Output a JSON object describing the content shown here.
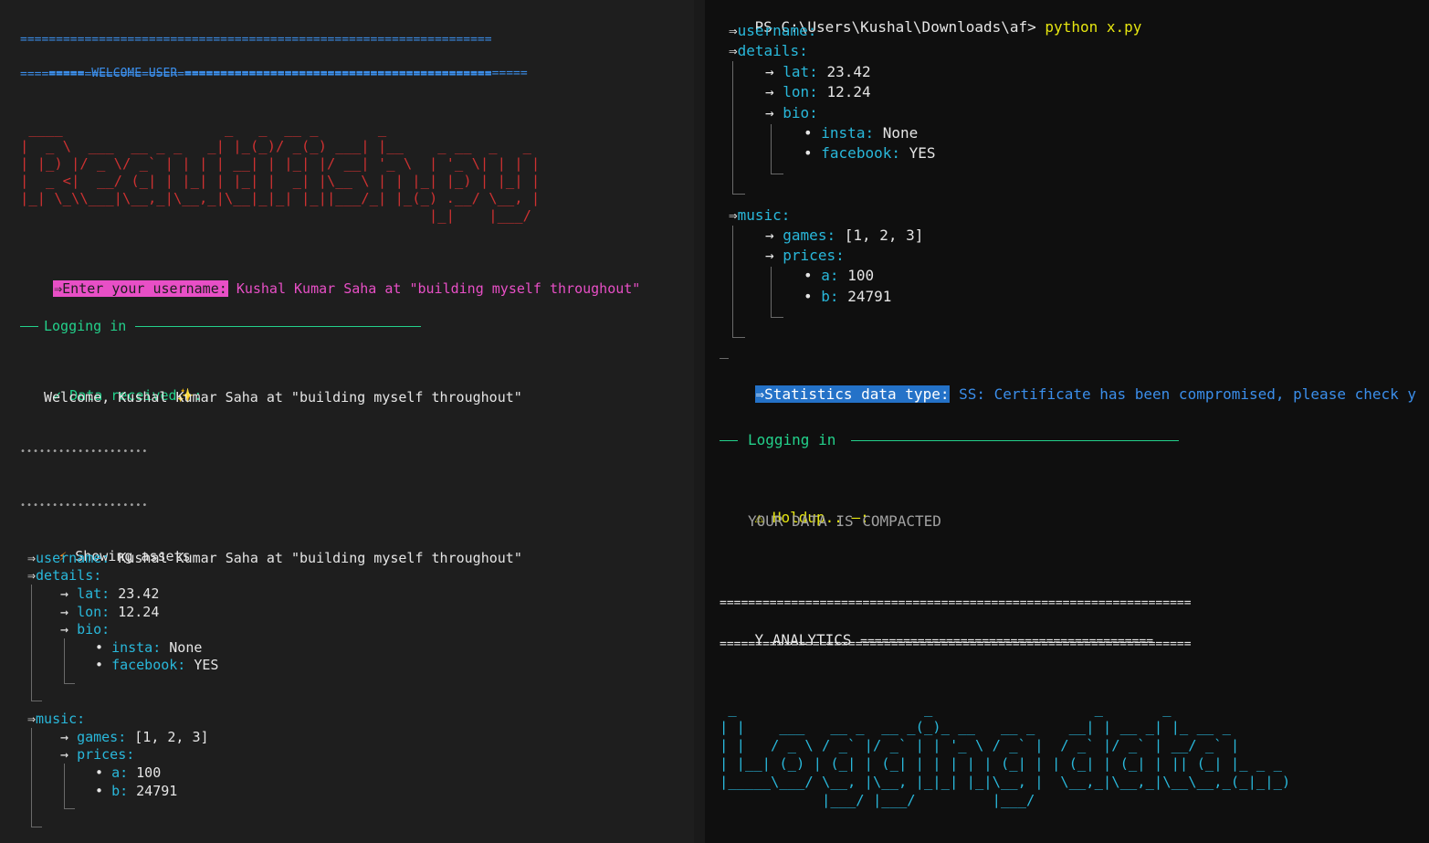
{
  "left": {
    "banner": {
      "line1": "==================================================================",
      "line2_label": "===== WELCOME USER",
      "line2_tail": "================================================",
      "line3": "=================================================================="
    },
    "ascii_title": " ____                   _   _  __ _       _                       \n|  _ \\  ___  __ _ _   _| |_(_)/ _(_) ___| |__    _ __  _   _    \n| |_) |/ _ \\/ _` | | | | __| | |_| |/ __| '_ \\  | '_ \\| | | |   \n|  _ <|  __/ (_| | |_| | |_| |  _| |\\__ \\ | | |_| |_) | |_| |   \n|_| \\_\\\\___|\\__,_|\\__,_|\\__|_|_| |_||___/_| |_(_) .__/ \\__, |   \n                                                |_|    |___/    ",
    "prompt": {
      "arrow": "⇒",
      "label": "Enter your username:",
      "value": "Kushal Kumar Saha at \"building myself throughout\""
    },
    "logging_title": "Logging in",
    "check_icon": "✓",
    "received_label": "Data received",
    "sparkle_icon": "✨",
    "welcome_text": "Welcome, Kushal Kumar Saha at \"building myself throughout\"",
    "dots1": "••••••••••••••••••••",
    "dots2": "••••••••••••••••••••",
    "assets_icon": "⚡",
    "assets_label": "Showing assets",
    "username_key": "username:",
    "username_value": "Kushal Kumar Saha at \"building myself throughout\"",
    "details_key": "details:",
    "lat_key": "lat:",
    "lat_value": "23.42",
    "lon_key": "lon:",
    "lon_value": "12.24",
    "bio_key": "bio:",
    "insta_key": "insta:",
    "insta_value": "None",
    "facebook_key": "facebook:",
    "facebook_value": "YES",
    "music_key": "music:",
    "games_key": "games:",
    "games_value": "[1, 2, 3]",
    "prices_key": "prices:",
    "a_key": "a:",
    "a_value": "100",
    "b_key": "b:",
    "b_value": "24791"
  },
  "right": {
    "ps_prompt": "PS C:\\Users\\Kushal\\Downloads\\af>",
    "ps_command": "python x.py",
    "username_key": "username:",
    "details_key": "details:",
    "lat_key": "lat:",
    "lat_value": "23.42",
    "lon_key": "lon:",
    "lon_value": "12.24",
    "bio_key": "bio:",
    "insta_key": "insta:",
    "insta_value": "None",
    "facebook_key": "facebook:",
    "facebook_value": "YES",
    "music_key": "music:",
    "games_key": "games:",
    "games_value": "[1, 2, 3]",
    "prices_key": "prices:",
    "a_key": "a:",
    "a_value": "100",
    "b_key": "b:",
    "b_value": "24791",
    "stats": {
      "arrow": "⇒",
      "label": "Statistics data type:",
      "value": "SS: Certificate has been compromised, please check y"
    },
    "logging_title": "Logging in",
    "warn_icon": "⚠",
    "holdup_label": "Holdup.. —:",
    "compacted_text": "YOUR DATA IS COMPACTED",
    "banner": {
      "line1": "==================================================================",
      "line2_label": "Y ANALYTICS",
      "line2_tail": "=========================================",
      "line3": "=================================================================="
    },
    "ascii_logging": " _                      _                   _       _          \n| |    ___   __ _  __ _(_)_ __   __ _    __| | __ _| |_ __ _    \n| |   / _ \\ / _` |/ _` | | '_ \\ / _` |  / _` |/ _` | __/ _` |   \n| |__| (_) | (_| | (_| | | | | | (_| | | (_| | (_| | || (_| |_ _ _\n|_____\\___/ \\__, |\\__, |_|_| |_|\\__, |  \\__,_|\\__,_|\\__\\__,_(_|_|_)\n            |___/ |___/         |___/                              "
  },
  "colors": {
    "cyan": "#29b8db",
    "blue": "#3b8eea",
    "green": "#23d18b",
    "yellow": "#e5e510",
    "ascii_red": "#cd3131",
    "magenta_bg": "#e84fc6",
    "stats_bg": "#2472c8"
  }
}
